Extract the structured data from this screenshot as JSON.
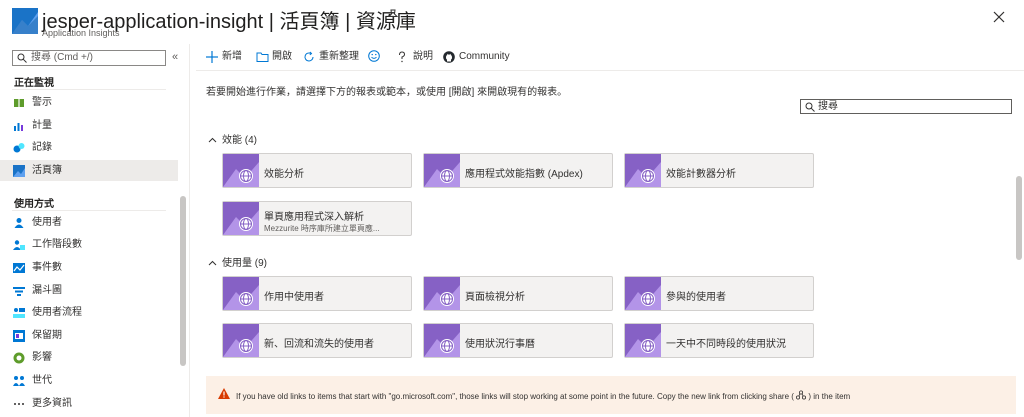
{
  "header": {
    "title": "jesper-application-insight | 活頁簿 | 資源庫",
    "subtitle": "Application Insights"
  },
  "sidebar": {
    "search_placeholder": "搜尋 (Cmd +/)",
    "collapse_glyph": "«",
    "groups": [
      "正在監視",
      "使用方式"
    ],
    "monitor_items": [
      "警示",
      "計量",
      "記錄",
      "活頁簿"
    ],
    "usage_items": [
      "使用者",
      "工作階段數",
      "事件數",
      "漏斗圖",
      "使用者流程",
      "保留期",
      "影響",
      "世代",
      "更多資訊"
    ]
  },
  "toolbar": {
    "new_label": "新增",
    "open_label": "開啟",
    "refresh_label": "重新整理",
    "feedback_icon": "smile-icon",
    "help_label": "說明",
    "community_label": "Community"
  },
  "main": {
    "instruction": "若要開始進行作業，請選擇下方的報表或範本，或使用 [開啟] 來開啟現有的報表。",
    "filter_placeholder": "搜尋",
    "sections": [
      {
        "title": "效能 (4)",
        "cards": [
          {
            "name": "效能分析",
            "desc": ""
          },
          {
            "name": "應用程式效能指數 (Apdex)",
            "desc": ""
          },
          {
            "name": "效能計數器分析",
            "desc": ""
          },
          {
            "name": "單頁應用程式深入解析",
            "desc": "Mezzurite 時序庫所建立單頁應..."
          }
        ]
      },
      {
        "title": "使用量 (9)",
        "cards": [
          {
            "name": "作用中使用者",
            "desc": ""
          },
          {
            "name": "頁面檢視分析",
            "desc": ""
          },
          {
            "name": "參與的使用者",
            "desc": ""
          },
          {
            "name": "新、回流和流失的使用者",
            "desc": ""
          },
          {
            "name": "使用狀況行事曆",
            "desc": ""
          },
          {
            "name": "一天中不同時段的使用狀況",
            "desc": ""
          }
        ]
      }
    ]
  },
  "banner": {
    "text": "If you have old links to items that start with \"go.microsoft.com\", those links will stop working at some point in the future. Copy the new link from clicking share (",
    "text_end": ") in the item"
  },
  "colors": {
    "accent": "#0078d4",
    "card_thumb": "#8661c5",
    "warning": "#d83b01"
  }
}
